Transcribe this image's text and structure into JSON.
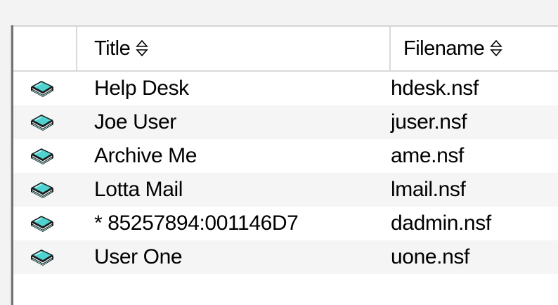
{
  "table": {
    "columns": [
      {
        "label": "Title",
        "sort_icon": "sort-updown-icon"
      },
      {
        "label": "Filename",
        "sort_icon": "sort-updown-icon"
      }
    ],
    "row_icon": "database-book-icon",
    "rows": [
      {
        "title": "Help Desk",
        "filename": "hdesk.nsf"
      },
      {
        "title": "Joe User",
        "filename": "juser.nsf"
      },
      {
        "title": "Archive Me",
        "filename": "ame.nsf"
      },
      {
        "title": "Lotta Mail",
        "filename": "lmail.nsf"
      },
      {
        "title": "* 85257894:001146D7",
        "filename": "dadmin.nsf"
      },
      {
        "title": "User One",
        "filename": "uone.nsf"
      }
    ]
  },
  "colors": {
    "icon_fill": "#4fd2d0",
    "icon_dark": "#1a1a1a",
    "header_border": "#d9d9d9"
  }
}
